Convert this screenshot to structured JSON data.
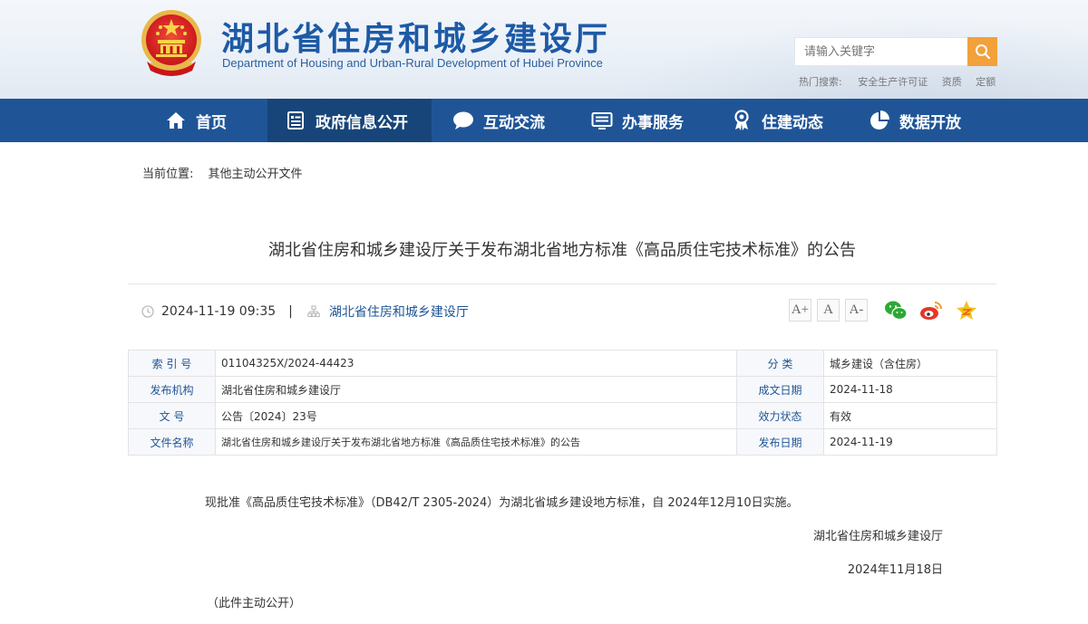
{
  "header": {
    "title": "湖北省住房和城乡建设厅",
    "subtitle": "Department of Housing and Urban-Rural Development of Hubei Province",
    "search_placeholder": "请输入关键字",
    "hot_label": "热门搜索:",
    "hot_items": [
      "安全生产许可证",
      "资质",
      "定额"
    ]
  },
  "nav": {
    "items": [
      {
        "label": "首页",
        "icon": "home-icon"
      },
      {
        "label": "政府信息公开",
        "icon": "document-list-icon",
        "active": true
      },
      {
        "label": "互动交流",
        "icon": "chat-bubble-icon"
      },
      {
        "label": "办事服务",
        "icon": "monitor-icon"
      },
      {
        "label": "住建动态",
        "icon": "badge-icon"
      },
      {
        "label": "数据开放",
        "icon": "pie-chart-icon"
      }
    ]
  },
  "breadcrumb": {
    "label": "当前位置:",
    "current": "其他主动公开文件"
  },
  "article": {
    "title": "湖北省住房和城乡建设厅关于发布湖北省地方标准《高品质住宅技术标准》的公告",
    "datetime": "2024-11-19 09:35",
    "separator": "|",
    "publisher": "湖北省住房和城乡建设厅",
    "font_sizes": [
      "A+",
      "A",
      "A-"
    ],
    "share_icons": [
      "wechat-icon",
      "weibo-icon",
      "favorite-icon"
    ]
  },
  "info_table": {
    "rows": [
      {
        "k1": "索 引 号",
        "v1": "01104325X/2024-44423",
        "k2": "分 类",
        "v2": "城乡建设（含住房）"
      },
      {
        "k1": "发布机构",
        "v1": "湖北省住房和城乡建设厅",
        "k2": "成文日期",
        "v2": "2024-11-18"
      },
      {
        "k1": "文 号",
        "v1": "公告〔2024〕23号",
        "k2": "效力状态",
        "v2": "有效"
      },
      {
        "k1": "文件名称",
        "v1": "湖北省住房和城乡建设厅关于发布湖北省地方标准《高品质住宅技术标准》的公告",
        "k2": "发布日期",
        "v2": "2024-11-19"
      }
    ]
  },
  "body": {
    "paragraph": "现批准《高品质住宅技术标准》（DB42/T 2305-2024）为湖北省城乡建设地方标准，自 2024年12月10日实施。",
    "signature_org": "湖北省住房和城乡建设厅",
    "signature_date": "2024年11月18日",
    "note": "（此件主动公开）"
  },
  "colors": {
    "nav_bg": "#1f5597",
    "nav_active": "#174579",
    "search_button": "#f2a13b",
    "title_blue": "#1d5aa6"
  }
}
